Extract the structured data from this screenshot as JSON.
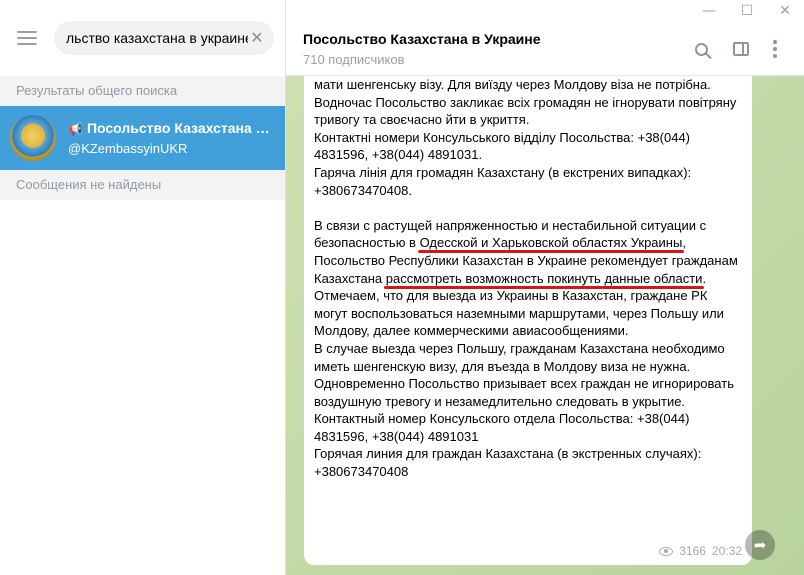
{
  "window": {
    "minimize": "—",
    "maximize": "☐",
    "close": "✕"
  },
  "sidebar": {
    "search_value": "льство казахстана в украине",
    "clear": "✕",
    "global_results_header": "Результаты общего поиска",
    "result": {
      "title": "Посольство Казахстана в Украине",
      "username": "@KZembassyinUKR",
      "icon": "megaphone-icon"
    },
    "messages_not_found": "Сообщения не найдены"
  },
  "chat": {
    "title": "Посольство Казахстана в Украине",
    "subtitle": "710 подписчиков",
    "message": {
      "uk": [
        "мати шенгенську візу. Для виїзду через Молдову віза не потрібна.",
        "Водночас Посольство закликає всіх громадян не ігнорувати повітряну тривогу та своєчасно йти в укриття.",
        "Контактні номери Консульського відділу Посольства: +38(044) 4831596, +38(044) 4891031.",
        "Гаряча лінія для громадян Казахстану (в екстрених випадках): +380673470408."
      ],
      "ru1_a": "В связи с растущей напряженностью и нестабильной ситуации с безопасностью в ",
      "ru1_ul1": "Одесской и Харьковской областях Украины",
      "ru1_b": ", Посольство Республики Казахстан в Украине рекомендует гражданам Казахстана ",
      "ru1_ul2": "рассмотреть возможность покинуть",
      "ru1_c": " ",
      "ru1_ul3": "данные области",
      "ru1_d": ".",
      "ru": [
        "Отмечаем, что для выезда из Украины в Казахстан, граждане РК могут воспользоваться наземными маршрутами, через Польшу или Молдову, далее коммерческими авиасообщениями.",
        "В случае выезда через Польшу, гражданам Казахстана необходимо иметь шенгенскую визу, для въезда в Молдову виза не нужна.",
        "Одновременно Посольство призывает всех граждан не игнорировать воздушную тревогу и незамедлительно следовать в укрытие.",
        "Контактный номер Консульского отдела Посольства: +38(044) 4831596, +38(044) 4891031",
        "Горячая линия для граждан Казахстана (в экстренных случаях): +380673470408"
      ],
      "views": "3166",
      "time": "20:32"
    },
    "share_icon": "➦"
  },
  "colors": {
    "accent": "#419fd9",
    "underline": "#d11818",
    "chat_bg": "#c9dcae"
  }
}
